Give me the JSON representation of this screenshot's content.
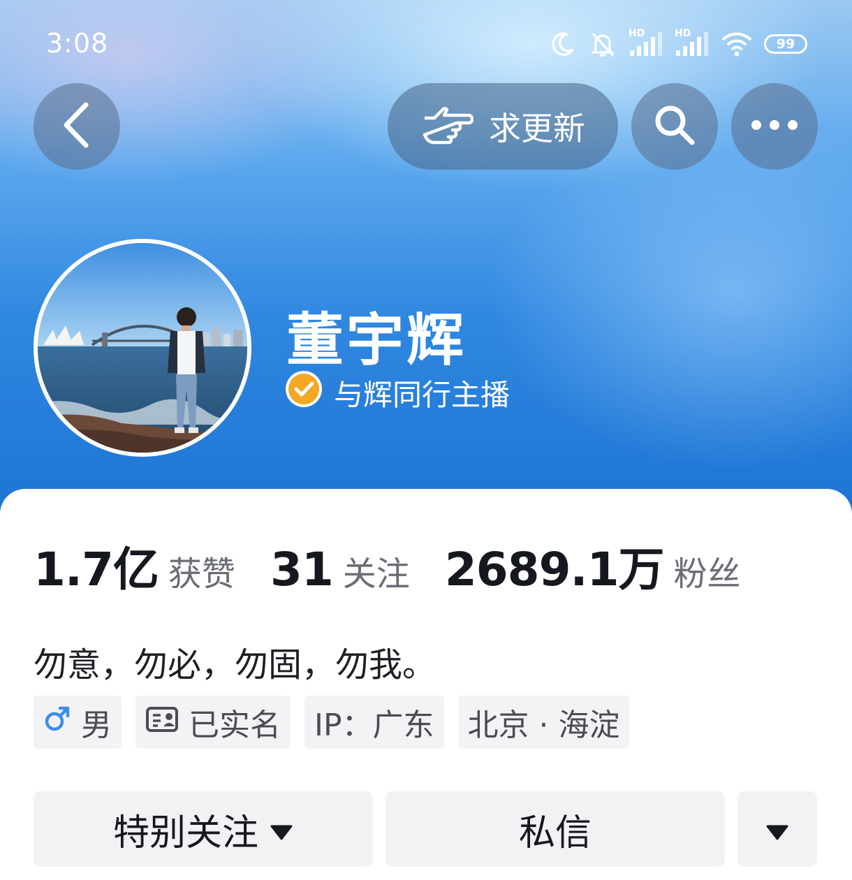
{
  "status_bar": {
    "time": "3:08",
    "signal_1_label": "HD",
    "signal_2_label": "HD",
    "battery": "99",
    "icons": [
      "moon-icon",
      "mute-bell-icon",
      "signal-icon",
      "signal-icon",
      "wifi-icon",
      "battery-icon"
    ]
  },
  "header": {
    "back_icon": "chevron-left-icon",
    "request_update_label": "求更新",
    "request_update_icon": "pointing-hand-icon",
    "search_icon": "search-icon",
    "more_icon": "more-dots-icon"
  },
  "profile": {
    "name": "董宇辉",
    "verified_title": "与辉同行主播",
    "verified_icon": "verified-check-icon",
    "avatar_image": "photo of man standing on rocks by harbour with opera house and bridge"
  },
  "stats": [
    {
      "value": "1.7亿",
      "label": "获赞"
    },
    {
      "value": "31",
      "label": "关注"
    },
    {
      "value": "2689.1万",
      "label": "粉丝"
    }
  ],
  "bio": "勿意，勿必，勿固，勿我。",
  "tags": {
    "gender": "男",
    "verified_name": "已实名",
    "ip": "IP：广东",
    "location": "北京 · 海淀"
  },
  "actions": {
    "follow_label": "特别关注",
    "message_label": "私信"
  },
  "colors": {
    "hero_top": "#9cc9f2",
    "hero_bottom": "#1e74d4",
    "verify_badge": "#f5a623",
    "male_icon": "#3b8ee8"
  }
}
